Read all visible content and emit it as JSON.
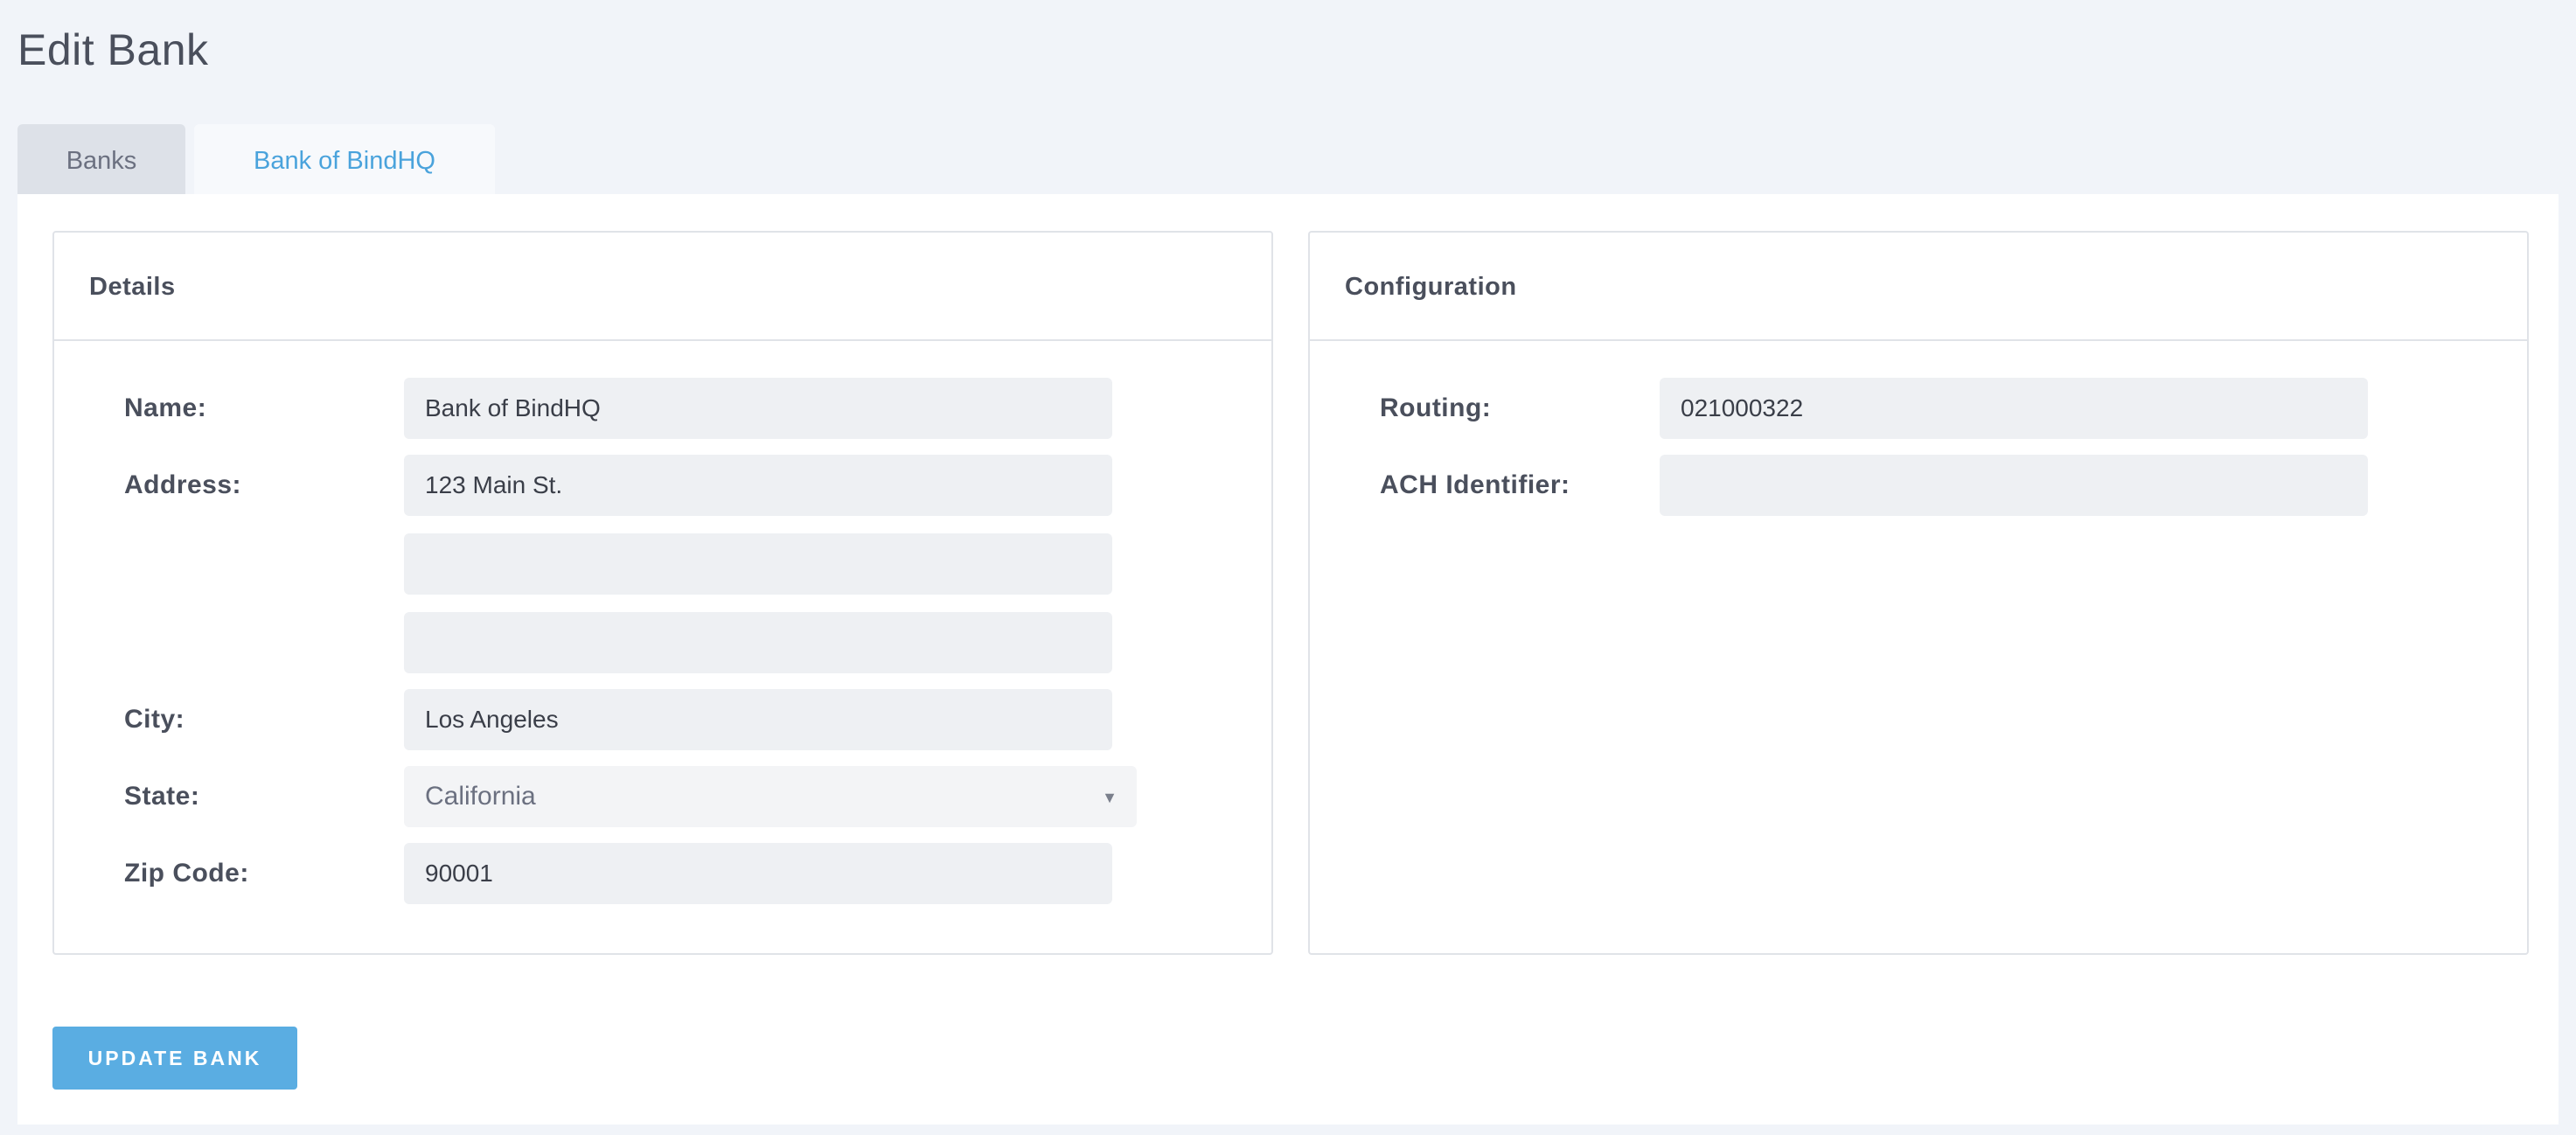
{
  "page": {
    "title": "Edit Bank"
  },
  "tabs": [
    {
      "label": "Banks",
      "active": false
    },
    {
      "label": "Bank of BindHQ",
      "active": true
    }
  ],
  "details": {
    "heading": "Details",
    "name_label": "Name:",
    "name_value": "Bank of BindHQ",
    "address_label": "Address:",
    "address_line1": "123 Main St.",
    "address_line2": "",
    "address_line3": "",
    "city_label": "City:",
    "city_value": "Los Angeles",
    "state_label": "State:",
    "state_value": "California",
    "zip_label": "Zip Code:",
    "zip_value": "90001"
  },
  "configuration": {
    "heading": "Configuration",
    "routing_label": "Routing:",
    "routing_value": "021000322",
    "ach_label": "ACH Identifier:",
    "ach_value": ""
  },
  "actions": {
    "update_label": "UPDATE BANK"
  },
  "colors": {
    "accent": "#5aade2",
    "active_tab_text": "#4aa3dc",
    "page_background": "#f1f4f9"
  },
  "icons": {
    "select_arrow": "chevron-down-icon"
  }
}
